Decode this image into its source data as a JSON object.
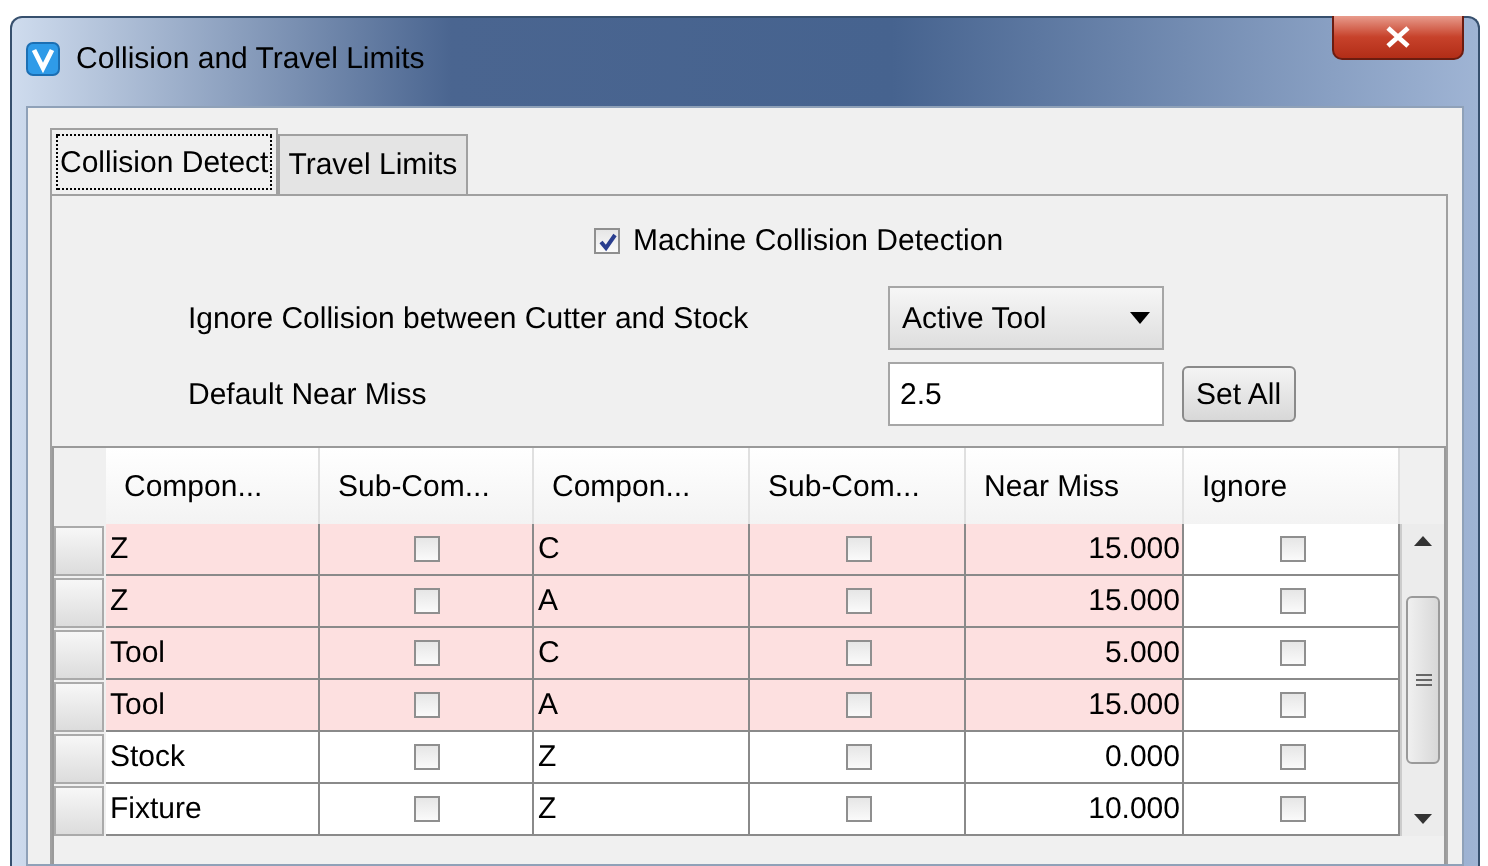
{
  "window": {
    "title": "Collision and Travel Limits"
  },
  "tabs": [
    {
      "label": "Collision Detect",
      "selected": true
    },
    {
      "label": "Travel Limits",
      "selected": false
    }
  ],
  "machine_collision_detection": {
    "label": "Machine Collision Detection",
    "checked": true
  },
  "ignore_collision": {
    "label": "Ignore Collision between Cutter and Stock",
    "value": "Active Tool"
  },
  "default_near_miss": {
    "label": "Default Near Miss",
    "value": "2.5",
    "button": "Set All"
  },
  "table": {
    "columns": [
      "Compon...",
      "Sub-Com...",
      "Compon...",
      "Sub-Com...",
      "Near Miss",
      "Ignore"
    ],
    "rows": [
      {
        "component": "Z",
        "sub_checked": false,
        "component_2": "C",
        "sub_2_checked": false,
        "near_miss": "15.000",
        "ignore": false,
        "highlighted": true
      },
      {
        "component": "Z",
        "sub_checked": false,
        "component_2": "A",
        "sub_2_checked": false,
        "near_miss": "15.000",
        "ignore": false,
        "highlighted": true
      },
      {
        "component": "Tool",
        "sub_checked": false,
        "component_2": "C",
        "sub_2_checked": false,
        "near_miss": "5.000",
        "ignore": false,
        "highlighted": true
      },
      {
        "component": "Tool",
        "sub_checked": false,
        "component_2": "A",
        "sub_2_checked": false,
        "near_miss": "15.000",
        "ignore": false,
        "highlighted": true
      },
      {
        "component": "Stock",
        "sub_checked": false,
        "component_2": "Z",
        "sub_2_checked": false,
        "near_miss": "0.000",
        "ignore": false,
        "highlighted": false
      },
      {
        "component": "Fixture",
        "sub_checked": false,
        "component_2": "Z",
        "sub_2_checked": false,
        "near_miss": "10.000",
        "ignore": false,
        "highlighted": false
      }
    ]
  }
}
